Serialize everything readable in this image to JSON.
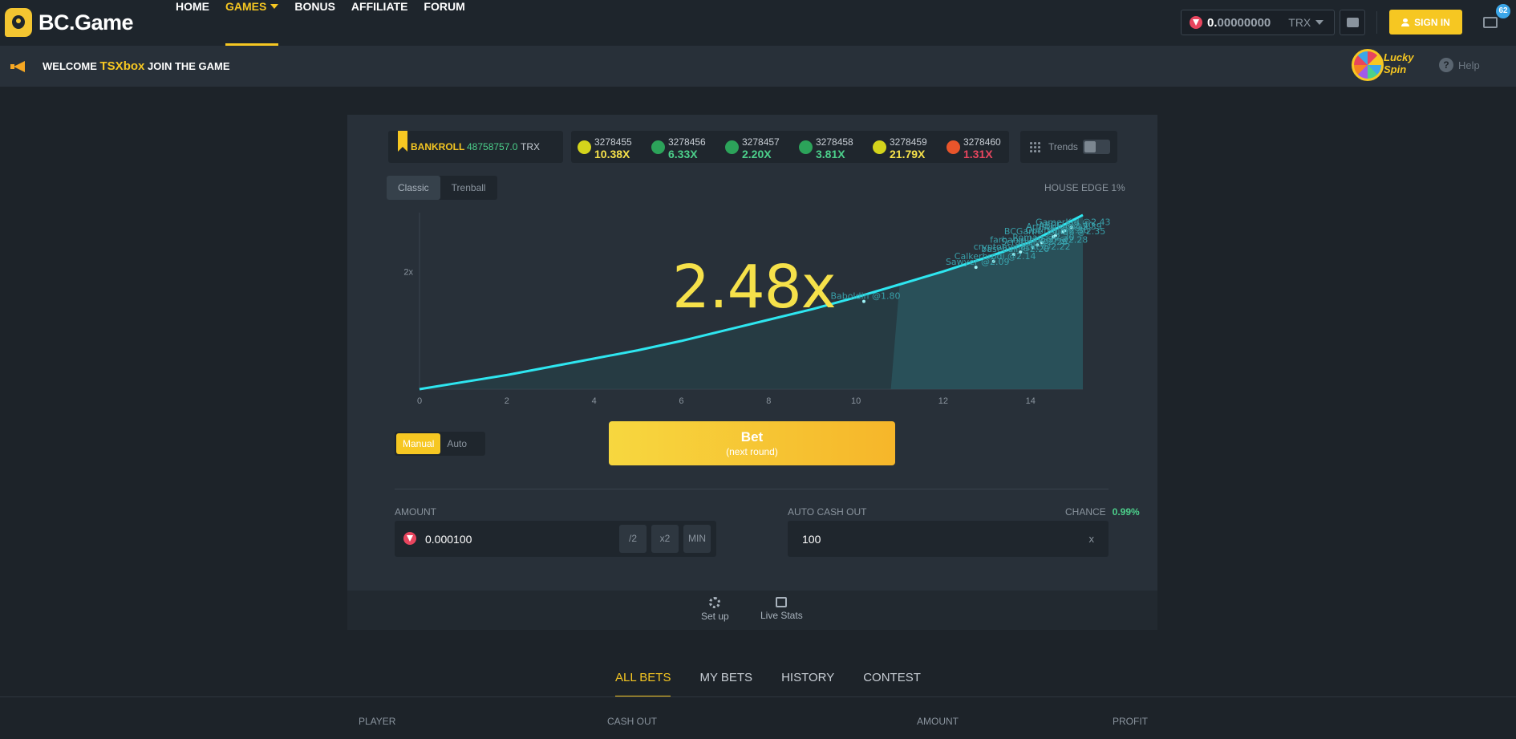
{
  "brand": {
    "name": "BC.Game"
  },
  "nav": [
    {
      "label": "HOME",
      "active": false
    },
    {
      "label": "GAMES",
      "active": true,
      "dropdown": true
    },
    {
      "label": "BONUS",
      "active": false
    },
    {
      "label": "AFFILIATE",
      "active": false
    },
    {
      "label": "FORUM",
      "active": false
    }
  ],
  "wallet": {
    "balance_int": "0.",
    "balance_dec": "00000000",
    "currency": "TRX",
    "icon": "trx-coin-icon"
  },
  "header": {
    "signin_label": "SIGN IN",
    "chat_badge": "62"
  },
  "welcome": {
    "prefix": "WELCOME",
    "username": "TSXbox",
    "suffix": "JOIN THE GAME"
  },
  "lucky_spin": {
    "line1": "Lucky",
    "line2": "Spin"
  },
  "help": {
    "label": "Help"
  },
  "bankroll": {
    "label": "BANKROLL",
    "value": "48758757.0",
    "currency": "TRX"
  },
  "history": [
    {
      "id": "3278455",
      "mult": "10.38X",
      "dot": "#d4d41c",
      "color": "#f6e14a"
    },
    {
      "id": "3278456",
      "mult": "6.33X",
      "dot": "#2ca35a",
      "color": "#4cd08b"
    },
    {
      "id": "3278457",
      "mult": "2.20X",
      "dot": "#2ca35a",
      "color": "#4cd08b"
    },
    {
      "id": "3278458",
      "mult": "3.81X",
      "dot": "#2ca35a",
      "color": "#4cd08b"
    },
    {
      "id": "3278459",
      "mult": "21.79X",
      "dot": "#d4d41c",
      "color": "#f6e14a"
    },
    {
      "id": "3278460",
      "mult": "1.31X",
      "dot": "#e8552b",
      "color": "#e8455e"
    }
  ],
  "trends": {
    "label": "Trends",
    "enabled": false
  },
  "modes": {
    "classic": "Classic",
    "trenball": "Trenball",
    "active": "Classic"
  },
  "house_edge": "HOUSE EDGE 1%",
  "game": {
    "multiplier": "2.48x"
  },
  "chart_data": {
    "type": "line",
    "title": "",
    "xlabel": "",
    "ylabel": "",
    "x_ticks": [
      "0",
      "2",
      "4",
      "6",
      "8",
      "10",
      "12",
      "14"
    ],
    "y_ticks": [
      "2x"
    ],
    "xlim": [
      0,
      15.2
    ],
    "ylim": [
      1.0,
      2.5
    ],
    "line_color": "#2ee6f0",
    "fill_color": "#2b5a63",
    "series": [
      {
        "x": [
          0,
          1,
          2,
          3,
          4,
          5,
          6,
          7,
          8,
          9,
          10,
          11,
          12,
          13,
          14,
          15.2
        ],
        "y": [
          1.0,
          1.06,
          1.12,
          1.19,
          1.26,
          1.33,
          1.41,
          1.5,
          1.59,
          1.68,
          1.78,
          1.89,
          2.0,
          2.12,
          2.25,
          2.48
        ]
      }
    ],
    "cashouts": [
      {
        "name": "GamerKid",
        "mult": "2.43"
      },
      {
        "name": "ABBC",
        "mult": "2.40"
      },
      {
        "name": "Artisticion",
        "mult": "2.39"
      },
      {
        "name": "Optima",
        "mult": "2.36"
      },
      {
        "name": "BCGame_Mumn",
        "mult": "2.35"
      },
      {
        "name": "Roman",
        "mult": "2.30"
      },
      {
        "name": "farhangjjbbood",
        "mult": "2.28"
      },
      {
        "name": "Scratter",
        "mult": "2.26"
      },
      {
        "name": "cryptomsnackt",
        "mult": "2.22"
      },
      {
        "name": "baseball",
        "mult": "2.20"
      },
      {
        "name": "Calkerbrodi",
        "mult": "2.14"
      },
      {
        "name": "Sawyer",
        "mult": "2.09"
      },
      {
        "name": "Baboldin",
        "mult": "1.80"
      }
    ]
  },
  "bet": {
    "mode_manual": "Manual",
    "mode_auto": "Auto",
    "button_label": "Bet",
    "button_sub": "(next round)",
    "amount_label": "AMOUNT",
    "amount_value": "0.000100",
    "half": "/2",
    "double": "x2",
    "min": "MIN",
    "auto_cashout_label": "AUTO CASH OUT",
    "auto_cashout_value": "100",
    "auto_cashout_suffix": "x",
    "chance_label": "CHANCE",
    "chance_value": "0.99%"
  },
  "footer_buttons": {
    "setup": "Set up",
    "live_stats": "Live Stats"
  },
  "bets_tabs": [
    "ALL BETS",
    "MY BETS",
    "HISTORY",
    "CONTEST"
  ],
  "table_headers": [
    "PLAYER",
    "CASH OUT",
    "AMOUNT",
    "PROFIT"
  ]
}
